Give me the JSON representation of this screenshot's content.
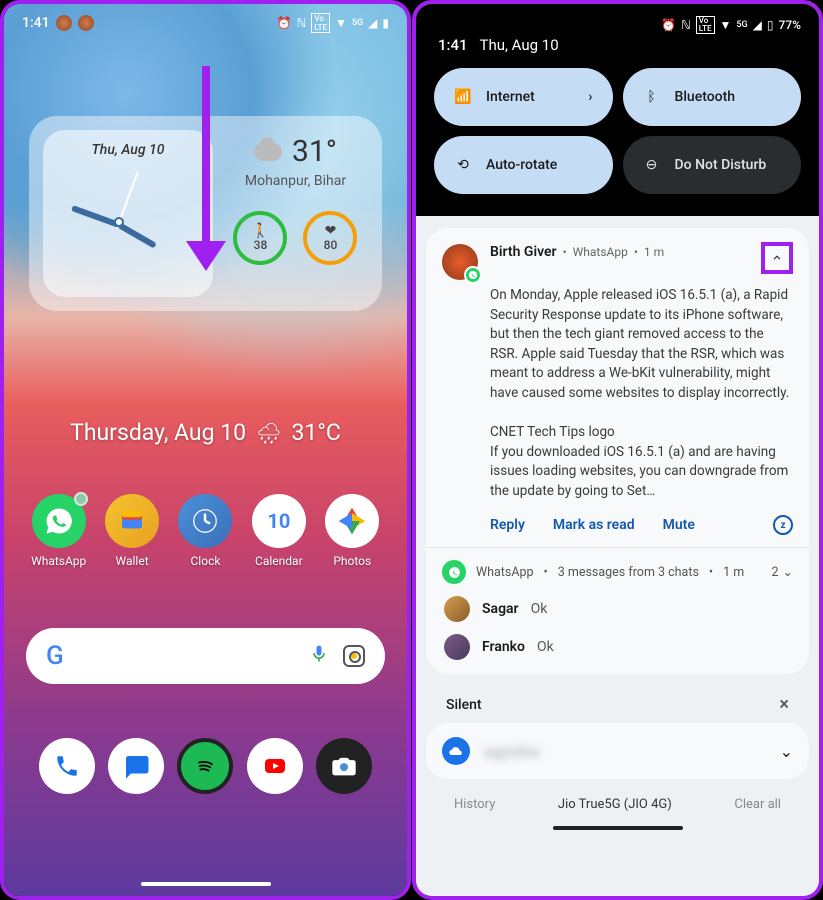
{
  "status": {
    "time": "1:41",
    "alarm": "⏰",
    "nfc": "N",
    "lte": "VoLTE",
    "sig": "5G",
    "battL": "◢",
    "battR": "77%"
  },
  "home": {
    "widget_date": "Thu, Aug 10",
    "temp": "31°",
    "location": "Mohanpur, Bihar",
    "steps": "38",
    "hearts": "80",
    "big_line_date": "Thursday, Aug 10",
    "big_line_temp": "31°C",
    "apps": [
      {
        "label": "WhatsApp"
      },
      {
        "label": "Wallet"
      },
      {
        "label": "Clock"
      },
      {
        "label": "Calendar"
      },
      {
        "label": "Photos"
      }
    ],
    "calendar_day": "10"
  },
  "shade": {
    "date_line": "Thu, Aug 10",
    "qs": {
      "internet": "Internet",
      "bluetooth": "Bluetooth",
      "autorotate": "Auto-rotate",
      "dnd": "Do Not Disturb"
    },
    "notif": {
      "sender": "Birth Giver",
      "app": "WhatsApp",
      "time": "1 m",
      "body1": "On Monday, Apple released iOS 16.5.1 (a), a Rapid Security Response update to its iPhone software, but then the tech giant removed access to the RSR. Apple said Tuesday that the RSR, which was meant to address a We-bKit vulnerability, might have caused some websites to display incorrectly.",
      "body2": "CNET Tech Tips logo",
      "body3": "If you downloaded iOS 16.5.1 (a) and are having issues loading websites, you can downgrade from the update by going to Set…",
      "actions": {
        "reply": "Reply",
        "read": "Mark as read",
        "mute": "Mute"
      }
    },
    "group": {
      "app": "WhatsApp",
      "summary": "3 messages from 3 chats",
      "time": "1 m",
      "count": "2",
      "convos": [
        {
          "name": "Sagar",
          "preview": "Ok"
        },
        {
          "name": "Franko",
          "preview": "Ok"
        }
      ]
    },
    "silent_label": "Silent",
    "silent_blur": "agyieba",
    "bottom": {
      "history": "History",
      "carrier": "Jio True5G (JIO 4G)",
      "clear": "Clear all"
    }
  }
}
